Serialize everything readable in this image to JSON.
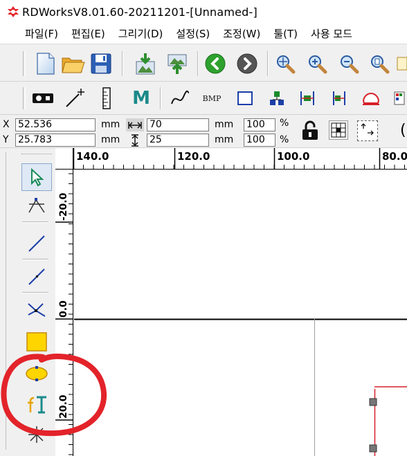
{
  "window": {
    "title": "RDWorksV8.01.60-20211201-[Unnamed-]"
  },
  "menu": {
    "items": [
      "파일(F)",
      "편집(E)",
      "그리기(D)",
      "설정(S)",
      "조정(W)",
      "툴(T)",
      "사용 모드"
    ]
  },
  "toolbar1": {
    "buttons": [
      "new-file",
      "open-folder",
      "save",
      "import",
      "export",
      "previous",
      "next",
      "zoom-pan",
      "zoom-in",
      "zoom-out",
      "zoom-page"
    ]
  },
  "toolbar2": {
    "buttons": [
      "laser-head",
      "pointer-wand",
      "ruler",
      "M",
      "curve",
      "BMP",
      "rectangle",
      "align",
      "distribute",
      "align-left",
      "shape"
    ],
    "m_label": "M",
    "bmp_label": "BMP"
  },
  "position": {
    "x_label": "X",
    "y_label": "Y",
    "x_value": "52.536",
    "y_value": "25.783",
    "unit_mm": "mm",
    "width_value": "70",
    "height_value": "25",
    "scale_x": "100",
    "scale_y": "100",
    "percent": "%"
  },
  "ruler": {
    "top_labels": [
      "140.0",
      "120.0",
      "100.0",
      "80.0"
    ],
    "left_labels": [
      "-20.0",
      "0.0",
      "20.0"
    ]
  },
  "left_tools": [
    "select",
    "node-edit",
    "line",
    "polyline",
    "bezier",
    "rectangle",
    "ellipse",
    "text",
    "star"
  ],
  "colors": {
    "accent_red": "#e3232a",
    "selection_red": "#d6202a",
    "rect_fill": "#ffd500",
    "ellipse_fill": "#ffd500"
  }
}
